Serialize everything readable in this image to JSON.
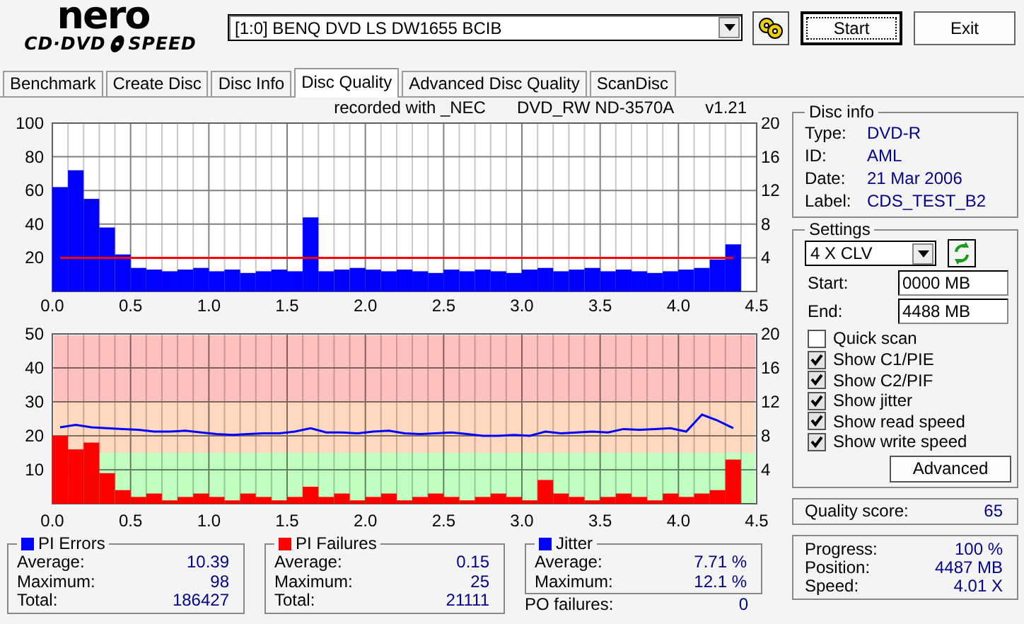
{
  "logo": {
    "brand": "nero",
    "line_1": "CD·DVD",
    "line_2": "SPEED"
  },
  "drive": {
    "value": "[1:0]  BENQ DVD LS DW1655 BCIB"
  },
  "buttons": [
    {
      "label": "Start",
      "focused": true
    },
    {
      "label": "Exit",
      "focused": false
    }
  ],
  "tabs": [
    {
      "label": "Benchmark",
      "selected": false
    },
    {
      "label": "Create Disc",
      "selected": false
    },
    {
      "label": "Disc Info",
      "selected": false
    },
    {
      "label": "Disc Quality",
      "selected": true
    },
    {
      "label": "Advanced Disc Quality",
      "selected": false
    },
    {
      "label": "ScanDisc",
      "selected": false
    }
  ],
  "chart_header": {
    "recorded_with": "recorded with _NEC",
    "recorder": "DVD_RW ND-3570A",
    "version": "v1.21"
  },
  "error_chart": {
    "chart_data": {
      "type": "bar",
      "grid": true,
      "x": [
        0.05,
        0.15,
        0.25,
        0.35,
        0.45,
        0.55,
        0.65,
        0.75,
        0.85,
        0.95,
        1.05,
        1.15,
        1.25,
        1.35,
        1.45,
        1.55,
        1.65,
        1.75,
        1.85,
        1.95,
        2.05,
        2.15,
        2.25,
        2.35,
        2.45,
        2.55,
        2.65,
        2.75,
        2.85,
        2.95,
        3.05,
        3.15,
        3.25,
        3.35,
        3.45,
        3.55,
        3.65,
        3.75,
        3.85,
        3.95,
        4.05,
        4.15,
        4.25,
        4.35
      ],
      "xlim": [
        0,
        4.5
      ],
      "ylim": [
        0,
        100
      ],
      "y2lim": [
        0,
        20
      ],
      "xticks": [
        {
          "value": 0,
          "label": "0.0"
        },
        {
          "value": 0.5,
          "label": "0.5"
        },
        {
          "value": 1,
          "label": "1.0"
        },
        {
          "value": 1.5,
          "label": "1.5"
        },
        {
          "value": 2,
          "label": "2.0"
        },
        {
          "value": 2.5,
          "label": "2.5"
        },
        {
          "value": 3,
          "label": "3.0"
        },
        {
          "value": 3.5,
          "label": "3.5"
        },
        {
          "value": 4,
          "label": "4.0"
        },
        {
          "value": 4.5,
          "label": "4.5"
        }
      ],
      "yticks": [
        20,
        40,
        60,
        80,
        100
      ],
      "y2ticks": [
        4,
        8,
        12,
        16,
        20
      ],
      "series": [
        {
          "color": "#0000ff",
          "type": "bar",
          "values": [
            62,
            72,
            55,
            38,
            22,
            14,
            13,
            12,
            13,
            14,
            12,
            13,
            11,
            12,
            13,
            12,
            44,
            12,
            13,
            14,
            13,
            12,
            13,
            12,
            11,
            13,
            12,
            13,
            12,
            11,
            13,
            14,
            12,
            13,
            14,
            12,
            13,
            12,
            11,
            12,
            13,
            14,
            19,
            28
          ]
        },
        {
          "color": "#ff0000",
          "type": "line",
          "axis": "y2",
          "values": [
            4,
            4,
            4,
            4,
            4,
            4,
            4,
            4,
            4,
            4,
            4,
            4,
            4,
            4,
            4,
            4,
            4,
            4,
            4,
            4,
            4,
            4,
            4,
            4,
            4,
            4,
            4,
            4,
            4,
            4,
            4,
            4,
            4,
            4,
            4,
            4,
            4,
            4,
            4,
            4,
            4,
            4,
            4,
            4
          ]
        }
      ]
    }
  },
  "failure_chart": {
    "chart_data": {
      "type": "bar",
      "grid": true,
      "x": [
        0.05,
        0.15,
        0.25,
        0.35,
        0.45,
        0.55,
        0.65,
        0.75,
        0.85,
        0.95,
        1.05,
        1.15,
        1.25,
        1.35,
        1.45,
        1.55,
        1.65,
        1.75,
        1.85,
        1.95,
        2.05,
        2.15,
        2.25,
        2.35,
        2.45,
        2.55,
        2.65,
        2.75,
        2.85,
        2.95,
        3.05,
        3.15,
        3.25,
        3.35,
        3.45,
        3.55,
        3.65,
        3.75,
        3.85,
        3.95,
        4.05,
        4.15,
        4.25,
        4.35
      ],
      "xlim": [
        0,
        4.5
      ],
      "ylim": [
        0,
        50
      ],
      "y2lim": [
        0,
        20
      ],
      "xticks": [
        {
          "value": 0,
          "label": "0.0"
        },
        {
          "value": 0.5,
          "label": "0.5"
        },
        {
          "value": 1,
          "label": "1.0"
        },
        {
          "value": 1.5,
          "label": "1.5"
        },
        {
          "value": 2,
          "label": "2.0"
        },
        {
          "value": 2.5,
          "label": "2.5"
        },
        {
          "value": 3,
          "label": "3.0"
        },
        {
          "value": 3.5,
          "label": "3.5"
        },
        {
          "value": 4,
          "label": "4.0"
        },
        {
          "value": 4.5,
          "label": "4.5"
        }
      ],
      "yticks": [
        10,
        20,
        30,
        40,
        50
      ],
      "y2ticks": [
        4,
        8,
        12,
        16,
        20
      ],
      "bands": [
        {
          "axis": "y",
          "from": 30,
          "to": 50,
          "color": "#ffc0c0"
        },
        {
          "axis": "y",
          "from": 15,
          "to": 30,
          "color": "#ffd8c0"
        },
        {
          "axis": "y",
          "from": 0,
          "to": 15,
          "color": "#c0ffc0"
        }
      ],
      "series": [
        {
          "color": "#ff0000",
          "type": "bar",
          "values": [
            20,
            16,
            18,
            9,
            4,
            2,
            3,
            1,
            2,
            3,
            2,
            1,
            3,
            2,
            1,
            2,
            5,
            2,
            3,
            1,
            2,
            3,
            1,
            2,
            3,
            2,
            1,
            2,
            3,
            2,
            1,
            7,
            3,
            2,
            1,
            2,
            3,
            2,
            1,
            3,
            2,
            3,
            4,
            13
          ]
        },
        {
          "color": "#0000ff",
          "type": "line",
          "axis": "y2",
          "values": [
            9.0,
            9.3,
            9.0,
            8.9,
            8.8,
            8.7,
            8.5,
            8.5,
            8.6,
            8.4,
            8.2,
            8.1,
            8.2,
            8.3,
            8.3,
            8.5,
            8.9,
            8.4,
            8.4,
            8.3,
            8.5,
            8.6,
            8.3,
            8.2,
            8.3,
            8.4,
            8.2,
            8.0,
            8.0,
            8.1,
            8.0,
            8.5,
            8.3,
            8.4,
            8.5,
            8.4,
            8.8,
            8.7,
            8.8,
            8.9,
            8.5,
            10.5,
            9.8,
            8.9
          ]
        }
      ]
    }
  },
  "stats": [
    {
      "title": "PI Errors",
      "color": "#0000ff",
      "rows": [
        {
          "label": "Average:",
          "value": "10.39"
        },
        {
          "label": "Maximum:",
          "value": "98"
        },
        {
          "label": "Total:",
          "value": "186427"
        }
      ]
    },
    {
      "title": "PI Failures",
      "color": "#ff0000",
      "rows": [
        {
          "label": "Average:",
          "value": "0.15"
        },
        {
          "label": "Maximum:",
          "value": "25"
        },
        {
          "label": "Total:",
          "value": "21111"
        }
      ]
    },
    {
      "title": "Jitter",
      "color": "#0000ff",
      "rows": [
        {
          "label": "Average:",
          "value": "7.71 %"
        },
        {
          "label": "Maximum:",
          "value": "12.1 %"
        }
      ]
    }
  ],
  "po_failures": {
    "label": "PO failures:",
    "value": "0"
  },
  "disc_info": {
    "title": "Disc info",
    "rows": [
      {
        "label": "Type:",
        "value": "DVD-R"
      },
      {
        "label": "ID:",
        "value": "AML"
      },
      {
        "label": "Date:",
        "value": "21 Mar 2006"
      },
      {
        "label": "Label:",
        "value": "CDS_TEST_B2"
      }
    ]
  },
  "settings": {
    "title": "Settings",
    "speed": "4 X CLV",
    "start": {
      "label": "Start:",
      "value": "0000 MB"
    },
    "end": {
      "label": "End:",
      "value": "4488 MB"
    },
    "options": [
      {
        "label": "Quick scan",
        "checked": false
      },
      {
        "label": "Show C1/PIE",
        "checked": true
      },
      {
        "label": "Show C2/PIF",
        "checked": true
      },
      {
        "label": "Show jitter",
        "checked": true
      },
      {
        "label": "Show read speed",
        "checked": true
      },
      {
        "label": "Show write speed",
        "checked": true
      }
    ],
    "advanced": "Advanced"
  },
  "quality_score": {
    "label": "Quality score:",
    "value": "65"
  },
  "progress": [
    {
      "label": "Progress:",
      "value": "100 %"
    },
    {
      "label": "Position:",
      "value": "4487 MB"
    },
    {
      "label": "Speed:",
      "value": "4.01 X"
    }
  ]
}
